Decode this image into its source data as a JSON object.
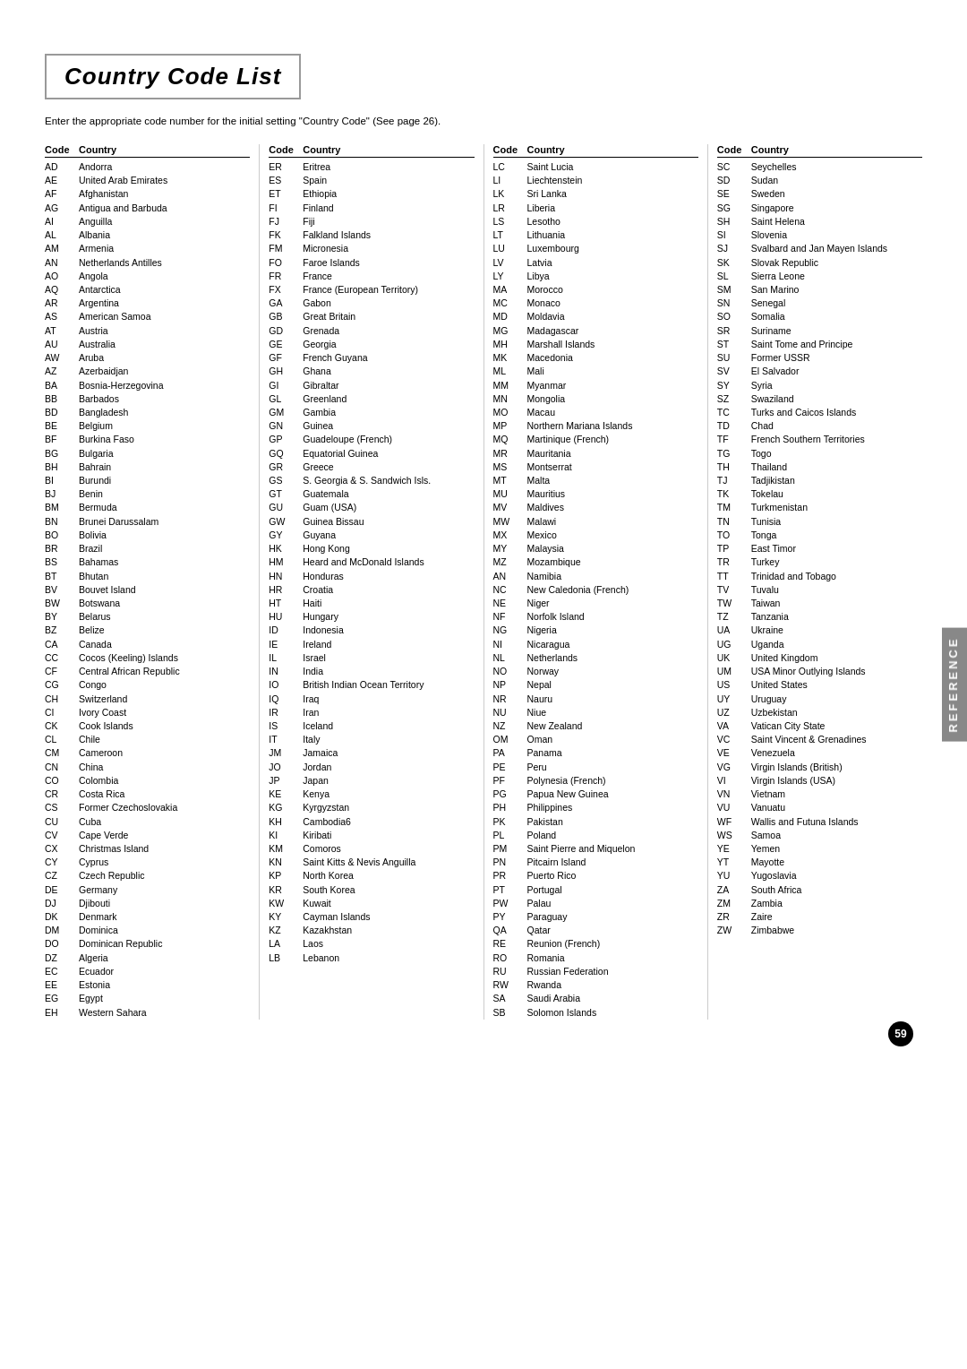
{
  "page": {
    "title": "Country Code List",
    "subtitle": "Enter the appropriate code number for the initial setting \"Country Code\" (See page 26).",
    "page_number": "59",
    "side_tab": "REFERENCE"
  },
  "columns": [
    {
      "header": {
        "code": "Code",
        "country": "Country"
      },
      "entries": [
        {
          "code": "AD",
          "country": "Andorra"
        },
        {
          "code": "AE",
          "country": "United Arab Emirates"
        },
        {
          "code": "AF",
          "country": "Afghanistan"
        },
        {
          "code": "AG",
          "country": "Antigua and Barbuda"
        },
        {
          "code": "AI",
          "country": "Anguilla"
        },
        {
          "code": "AL",
          "country": "Albania"
        },
        {
          "code": "AM",
          "country": "Armenia"
        },
        {
          "code": "AN",
          "country": "Netherlands Antilles"
        },
        {
          "code": "AO",
          "country": "Angola"
        },
        {
          "code": "AQ",
          "country": "Antarctica"
        },
        {
          "code": "AR",
          "country": "Argentina"
        },
        {
          "code": "AS",
          "country": "American Samoa"
        },
        {
          "code": "AT",
          "country": "Austria"
        },
        {
          "code": "AU",
          "country": "Australia"
        },
        {
          "code": "AW",
          "country": "Aruba"
        },
        {
          "code": "AZ",
          "country": "Azerbaidjan"
        },
        {
          "code": "BA",
          "country": "Bosnia-Herzegovina"
        },
        {
          "code": "BB",
          "country": "Barbados"
        },
        {
          "code": "BD",
          "country": "Bangladesh"
        },
        {
          "code": "BE",
          "country": "Belgium"
        },
        {
          "code": "BF",
          "country": "Burkina Faso"
        },
        {
          "code": "BG",
          "country": "Bulgaria"
        },
        {
          "code": "BH",
          "country": "Bahrain"
        },
        {
          "code": "BI",
          "country": "Burundi"
        },
        {
          "code": "BJ",
          "country": "Benin"
        },
        {
          "code": "BM",
          "country": "Bermuda"
        },
        {
          "code": "BN",
          "country": "Brunei Darussalam"
        },
        {
          "code": "BO",
          "country": "Bolivia"
        },
        {
          "code": "BR",
          "country": "Brazil"
        },
        {
          "code": "BS",
          "country": "Bahamas"
        },
        {
          "code": "BT",
          "country": "Bhutan"
        },
        {
          "code": "BV",
          "country": "Bouvet Island"
        },
        {
          "code": "BW",
          "country": "Botswana"
        },
        {
          "code": "BY",
          "country": "Belarus"
        },
        {
          "code": "BZ",
          "country": "Belize"
        },
        {
          "code": "CA",
          "country": "Canada"
        },
        {
          "code": "CC",
          "country": "Cocos (Keeling) Islands"
        },
        {
          "code": "CF",
          "country": "Central African Republic"
        },
        {
          "code": "CG",
          "country": "Congo"
        },
        {
          "code": "CH",
          "country": "Switzerland"
        },
        {
          "code": "CI",
          "country": "Ivory Coast"
        },
        {
          "code": "CK",
          "country": "Cook Islands"
        },
        {
          "code": "CL",
          "country": "Chile"
        },
        {
          "code": "CM",
          "country": "Cameroon"
        },
        {
          "code": "CN",
          "country": "China"
        },
        {
          "code": "CO",
          "country": "Colombia"
        },
        {
          "code": "CR",
          "country": "Costa Rica"
        },
        {
          "code": "CS",
          "country": "Former Czechoslovakia"
        },
        {
          "code": "CU",
          "country": "Cuba"
        },
        {
          "code": "CV",
          "country": "Cape Verde"
        },
        {
          "code": "CX",
          "country": "Christmas Island"
        },
        {
          "code": "CY",
          "country": "Cyprus"
        },
        {
          "code": "CZ",
          "country": "Czech Republic"
        },
        {
          "code": "DE",
          "country": "Germany"
        },
        {
          "code": "DJ",
          "country": "Djibouti"
        },
        {
          "code": "DK",
          "country": "Denmark"
        },
        {
          "code": "DM",
          "country": "Dominica"
        },
        {
          "code": "DO",
          "country": "Dominican Republic"
        },
        {
          "code": "DZ",
          "country": "Algeria"
        },
        {
          "code": "EC",
          "country": "Ecuador"
        },
        {
          "code": "EE",
          "country": "Estonia"
        },
        {
          "code": "EG",
          "country": "Egypt"
        },
        {
          "code": "EH",
          "country": "Western Sahara"
        }
      ]
    },
    {
      "header": {
        "code": "Code",
        "country": "Country"
      },
      "entries": [
        {
          "code": "ER",
          "country": "Eritrea"
        },
        {
          "code": "ES",
          "country": "Spain"
        },
        {
          "code": "ET",
          "country": "Ethiopia"
        },
        {
          "code": "FI",
          "country": "Finland"
        },
        {
          "code": "FJ",
          "country": "Fiji"
        },
        {
          "code": "FK",
          "country": "Falkland Islands"
        },
        {
          "code": "FM",
          "country": "Micronesia"
        },
        {
          "code": "FO",
          "country": "Faroe Islands"
        },
        {
          "code": "FR",
          "country": "France"
        },
        {
          "code": "FX",
          "country": "France (European Territory)"
        },
        {
          "code": "GA",
          "country": "Gabon"
        },
        {
          "code": "GB",
          "country": "Great Britain"
        },
        {
          "code": "GD",
          "country": "Grenada"
        },
        {
          "code": "GE",
          "country": "Georgia"
        },
        {
          "code": "GF",
          "country": "French Guyana"
        },
        {
          "code": "GH",
          "country": "Ghana"
        },
        {
          "code": "GI",
          "country": "Gibraltar"
        },
        {
          "code": "GL",
          "country": "Greenland"
        },
        {
          "code": "GM",
          "country": "Gambia"
        },
        {
          "code": "GN",
          "country": "Guinea"
        },
        {
          "code": "GP",
          "country": "Guadeloupe (French)"
        },
        {
          "code": "GQ",
          "country": "Equatorial Guinea"
        },
        {
          "code": "GR",
          "country": "Greece"
        },
        {
          "code": "GS",
          "country": "S. Georgia & S. Sandwich Isls."
        },
        {
          "code": "GT",
          "country": "Guatemala"
        },
        {
          "code": "GU",
          "country": "Guam (USA)"
        },
        {
          "code": "GW",
          "country": "Guinea Bissau"
        },
        {
          "code": "GY",
          "country": "Guyana"
        },
        {
          "code": "HK",
          "country": "Hong Kong"
        },
        {
          "code": "HM",
          "country": "Heard and McDonald Islands"
        },
        {
          "code": "HN",
          "country": "Honduras"
        },
        {
          "code": "HR",
          "country": "Croatia"
        },
        {
          "code": "HT",
          "country": "Haiti"
        },
        {
          "code": "HU",
          "country": "Hungary"
        },
        {
          "code": "ID",
          "country": "Indonesia"
        },
        {
          "code": "IE",
          "country": "Ireland"
        },
        {
          "code": "IL",
          "country": "Israel"
        },
        {
          "code": "IN",
          "country": "India"
        },
        {
          "code": "IO",
          "country": "British Indian Ocean Territory"
        },
        {
          "code": "IQ",
          "country": "Iraq"
        },
        {
          "code": "IR",
          "country": "Iran"
        },
        {
          "code": "IS",
          "country": "Iceland"
        },
        {
          "code": "IT",
          "country": "Italy"
        },
        {
          "code": "JM",
          "country": "Jamaica"
        },
        {
          "code": "JO",
          "country": "Jordan"
        },
        {
          "code": "JP",
          "country": "Japan"
        },
        {
          "code": "KE",
          "country": "Kenya"
        },
        {
          "code": "KG",
          "country": "Kyrgyzstan"
        },
        {
          "code": "KH",
          "country": "Cambodia6"
        },
        {
          "code": "KI",
          "country": "Kiribati"
        },
        {
          "code": "KM",
          "country": "Comoros"
        },
        {
          "code": "KN",
          "country": "Saint Kitts & Nevis Anguilla"
        },
        {
          "code": "KP",
          "country": "North Korea"
        },
        {
          "code": "KR",
          "country": "South Korea"
        },
        {
          "code": "KW",
          "country": "Kuwait"
        },
        {
          "code": "KY",
          "country": "Cayman Islands"
        },
        {
          "code": "KZ",
          "country": "Kazakhstan"
        },
        {
          "code": "LA",
          "country": "Laos"
        },
        {
          "code": "LB",
          "country": "Lebanon"
        }
      ]
    },
    {
      "header": {
        "code": "Code",
        "country": "Country"
      },
      "entries": [
        {
          "code": "LC",
          "country": "Saint Lucia"
        },
        {
          "code": "LI",
          "country": "Liechtenstein"
        },
        {
          "code": "LK",
          "country": "Sri Lanka"
        },
        {
          "code": "LR",
          "country": "Liberia"
        },
        {
          "code": "LS",
          "country": "Lesotho"
        },
        {
          "code": "LT",
          "country": "Lithuania"
        },
        {
          "code": "LU",
          "country": "Luxembourg"
        },
        {
          "code": "LV",
          "country": "Latvia"
        },
        {
          "code": "LY",
          "country": "Libya"
        },
        {
          "code": "MA",
          "country": "Morocco"
        },
        {
          "code": "MC",
          "country": "Monaco"
        },
        {
          "code": "MD",
          "country": "Moldavia"
        },
        {
          "code": "MG",
          "country": "Madagascar"
        },
        {
          "code": "MH",
          "country": "Marshall Islands"
        },
        {
          "code": "MK",
          "country": "Macedonia"
        },
        {
          "code": "ML",
          "country": "Mali"
        },
        {
          "code": "MM",
          "country": "Myanmar"
        },
        {
          "code": "MN",
          "country": "Mongolia"
        },
        {
          "code": "MO",
          "country": "Macau"
        },
        {
          "code": "MP",
          "country": "Northern Mariana Islands"
        },
        {
          "code": "MQ",
          "country": "Martinique (French)"
        },
        {
          "code": "MR",
          "country": "Mauritania"
        },
        {
          "code": "MS",
          "country": "Montserrat"
        },
        {
          "code": "MT",
          "country": "Malta"
        },
        {
          "code": "MU",
          "country": "Mauritius"
        },
        {
          "code": "MV",
          "country": "Maldives"
        },
        {
          "code": "MW",
          "country": "Malawi"
        },
        {
          "code": "MX",
          "country": "Mexico"
        },
        {
          "code": "MY",
          "country": "Malaysia"
        },
        {
          "code": "MZ",
          "country": "Mozambique"
        },
        {
          "code": "AN",
          "country": "Namibia"
        },
        {
          "code": "NC",
          "country": "New Caledonia (French)"
        },
        {
          "code": "NE",
          "country": "Niger"
        },
        {
          "code": "NF",
          "country": "Norfolk Island"
        },
        {
          "code": "NG",
          "country": "Nigeria"
        },
        {
          "code": "NI",
          "country": "Nicaragua"
        },
        {
          "code": "NL",
          "country": "Netherlands"
        },
        {
          "code": "NO",
          "country": "Norway"
        },
        {
          "code": "NP",
          "country": "Nepal"
        },
        {
          "code": "NR",
          "country": "Nauru"
        },
        {
          "code": "NU",
          "country": "Niue"
        },
        {
          "code": "NZ",
          "country": "New Zealand"
        },
        {
          "code": "OM",
          "country": "Oman"
        },
        {
          "code": "PA",
          "country": "Panama"
        },
        {
          "code": "PE",
          "country": "Peru"
        },
        {
          "code": "PF",
          "country": "Polynesia (French)"
        },
        {
          "code": "PG",
          "country": "Papua New Guinea"
        },
        {
          "code": "PH",
          "country": "Philippines"
        },
        {
          "code": "PK",
          "country": "Pakistan"
        },
        {
          "code": "PL",
          "country": "Poland"
        },
        {
          "code": "PM",
          "country": "Saint Pierre and Miquelon"
        },
        {
          "code": "PN",
          "country": "Pitcairn Island"
        },
        {
          "code": "PR",
          "country": "Puerto Rico"
        },
        {
          "code": "PT",
          "country": "Portugal"
        },
        {
          "code": "PW",
          "country": "Palau"
        },
        {
          "code": "PY",
          "country": "Paraguay"
        },
        {
          "code": "QA",
          "country": "Qatar"
        },
        {
          "code": "RE",
          "country": "Reunion (French)"
        },
        {
          "code": "RO",
          "country": "Romania"
        },
        {
          "code": "RU",
          "country": "Russian Federation"
        },
        {
          "code": "RW",
          "country": "Rwanda"
        },
        {
          "code": "SA",
          "country": "Saudi Arabia"
        },
        {
          "code": "SB",
          "country": "Solomon Islands"
        }
      ]
    },
    {
      "header": {
        "code": "Code",
        "country": "Country"
      },
      "entries": [
        {
          "code": "SC",
          "country": "Seychelles"
        },
        {
          "code": "SD",
          "country": "Sudan"
        },
        {
          "code": "SE",
          "country": "Sweden"
        },
        {
          "code": "SG",
          "country": "Singapore"
        },
        {
          "code": "SH",
          "country": "Saint Helena"
        },
        {
          "code": "SI",
          "country": "Slovenia"
        },
        {
          "code": "SJ",
          "country": "Svalbard and Jan Mayen Islands"
        },
        {
          "code": "SK",
          "country": "Slovak Republic"
        },
        {
          "code": "SL",
          "country": "Sierra Leone"
        },
        {
          "code": "SM",
          "country": "San Marino"
        },
        {
          "code": "SN",
          "country": "Senegal"
        },
        {
          "code": "SO",
          "country": "Somalia"
        },
        {
          "code": "SR",
          "country": "Suriname"
        },
        {
          "code": "ST",
          "country": "Saint Tome and Principe"
        },
        {
          "code": "SU",
          "country": "Former USSR"
        },
        {
          "code": "SV",
          "country": "El Salvador"
        },
        {
          "code": "SY",
          "country": "Syria"
        },
        {
          "code": "SZ",
          "country": "Swaziland"
        },
        {
          "code": "TC",
          "country": "Turks and Caicos Islands"
        },
        {
          "code": "TD",
          "country": "Chad"
        },
        {
          "code": "TF",
          "country": "French Southern Territories"
        },
        {
          "code": "TG",
          "country": "Togo"
        },
        {
          "code": "TH",
          "country": "Thailand"
        },
        {
          "code": "TJ",
          "country": "Tadjikistan"
        },
        {
          "code": "TK",
          "country": "Tokelau"
        },
        {
          "code": "TM",
          "country": "Turkmenistan"
        },
        {
          "code": "TN",
          "country": "Tunisia"
        },
        {
          "code": "TO",
          "country": "Tonga"
        },
        {
          "code": "TP",
          "country": "East Timor"
        },
        {
          "code": "TR",
          "country": "Turkey"
        },
        {
          "code": "TT",
          "country": "Trinidad and Tobago"
        },
        {
          "code": "TV",
          "country": "Tuvalu"
        },
        {
          "code": "TW",
          "country": "Taiwan"
        },
        {
          "code": "TZ",
          "country": "Tanzania"
        },
        {
          "code": "UA",
          "country": "Ukraine"
        },
        {
          "code": "UG",
          "country": "Uganda"
        },
        {
          "code": "UK",
          "country": "United Kingdom"
        },
        {
          "code": "UM",
          "country": "USA Minor Outlying Islands"
        },
        {
          "code": "US",
          "country": "United States"
        },
        {
          "code": "UY",
          "country": "Uruguay"
        },
        {
          "code": "UZ",
          "country": "Uzbekistan"
        },
        {
          "code": "VA",
          "country": "Vatican City State"
        },
        {
          "code": "VC",
          "country": "Saint Vincent & Grenadines"
        },
        {
          "code": "VE",
          "country": "Venezuela"
        },
        {
          "code": "VG",
          "country": "Virgin Islands (British)"
        },
        {
          "code": "VI",
          "country": "Virgin Islands (USA)"
        },
        {
          "code": "VN",
          "country": "Vietnam"
        },
        {
          "code": "VU",
          "country": "Vanuatu"
        },
        {
          "code": "WF",
          "country": "Wallis and Futuna Islands"
        },
        {
          "code": "WS",
          "country": "Samoa"
        },
        {
          "code": "YE",
          "country": "Yemen"
        },
        {
          "code": "YT",
          "country": "Mayotte"
        },
        {
          "code": "YU",
          "country": "Yugoslavia"
        },
        {
          "code": "ZA",
          "country": "South Africa"
        },
        {
          "code": "ZM",
          "country": "Zambia"
        },
        {
          "code": "ZR",
          "country": "Zaire"
        },
        {
          "code": "ZW",
          "country": "Zimbabwe"
        }
      ]
    }
  ]
}
